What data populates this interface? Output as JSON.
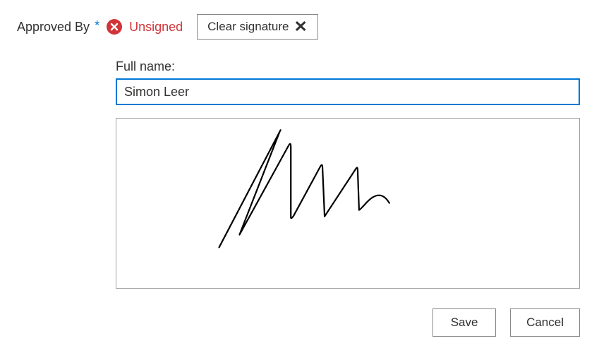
{
  "field": {
    "label": "Approved By",
    "required_mark": "*"
  },
  "status": {
    "text": "Unsigned"
  },
  "clear_button": {
    "label": "Clear signature"
  },
  "full_name": {
    "label": "Full name:",
    "value": "Simon Leer"
  },
  "actions": {
    "save": "Save",
    "cancel": "Cancel"
  },
  "icons": {
    "error": "error-circle-x",
    "clear_x": "✕"
  }
}
